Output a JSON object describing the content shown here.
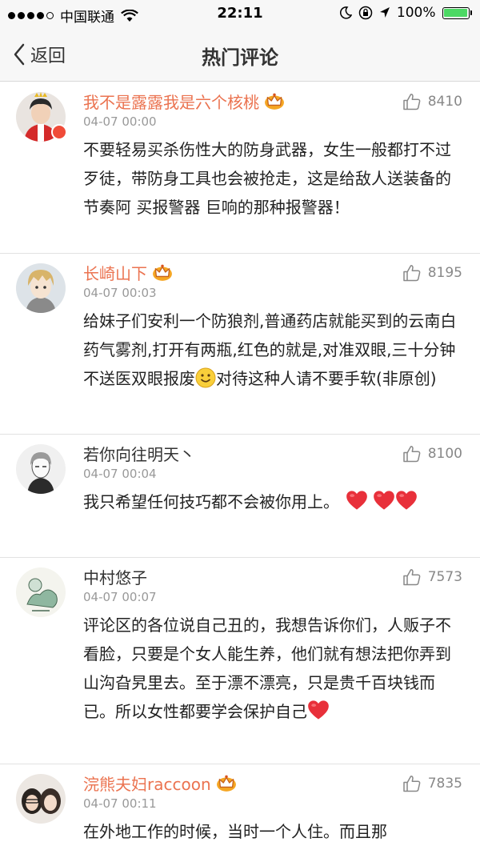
{
  "status_bar": {
    "carrier": "中国联通",
    "time": "22:11",
    "battery_percent": "100%",
    "battery_level": 1.0,
    "signal_bars": 4
  },
  "nav": {
    "back_label": "返回",
    "title": "热门评论"
  },
  "comments": [
    {
      "user": "我不是露露我是六个核桃",
      "vip": true,
      "time": "04-07 00:00",
      "likes": "8410",
      "text": "不要轻易买杀伤性大的防身武器，女生一般都打不过歹徒，带防身工具也会被抢走，这是给敌人送装备的节奏阿 买报警器 巨响的那种报警器！"
    },
    {
      "user": "长崎山下",
      "vip": true,
      "time": "04-07 00:03",
      "likes": "8195",
      "text_before_emoji": "给妹子们安利一个防狼剂,普通药店就能买到的云南白药气雾剂,打开有两瓶,红色的就是,对准双眼,三十分钟不送医双眼报废",
      "text_after_emoji": "对待这种人请不要手软(非原创)"
    },
    {
      "user": "若你向往明天丶",
      "vip": false,
      "time": "04-07 00:04",
      "likes": "8100",
      "text": "我只希望任何技巧都不会被你用上。"
    },
    {
      "user": "中村悠子",
      "vip": false,
      "time": "04-07 00:07",
      "likes": "7573",
      "text": "评论区的各位说自己丑的，我想告诉你们，人贩子不看脸，只要是个女人能生养，他们就有想法把你弄到山沟旮旯里去。至于漂不漂亮，只是贵千百块钱而已。所以女性都要学会保护自己"
    },
    {
      "user": "浣熊夫妇raccoon",
      "vip": true,
      "time": "04-07 00:11",
      "likes": "7835",
      "text": "在外地工作的时候，当时一个人住。而且那"
    }
  ],
  "icons": {
    "like": "thumbs-up-icon",
    "vip": "crown-icon",
    "heart": "red-heart-emoji",
    "smile": "smiley-emoji",
    "back": "chevron-left-icon"
  },
  "colors": {
    "vip_name": "#eb7350",
    "heart": "#e8303a",
    "battery": "#4cd964",
    "crown": "#f5a623"
  }
}
